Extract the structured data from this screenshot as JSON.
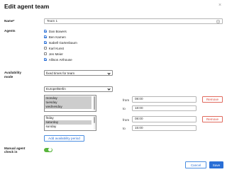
{
  "dialog": {
    "title": "Edit agent team",
    "close_symbol": "×"
  },
  "name_field": {
    "label": "Name*",
    "value": "Team 1",
    "icon": "id-card-icon"
  },
  "agents": {
    "label": "Agents",
    "items": [
      {
        "name": "Dan Bowers",
        "checked": true
      },
      {
        "name": "Ben Kamen",
        "checked": true
      },
      {
        "name": "Isabell Gartenbaum",
        "checked": true
      },
      {
        "name": "Karl Kunst",
        "checked": false
      },
      {
        "name": "Jen Meier",
        "checked": false
      },
      {
        "name": "Allison Arthouse",
        "checked": true
      }
    ]
  },
  "availability": {
    "label_line1": "Availability",
    "label_line2": "mode",
    "mode_value": "fixed times for team",
    "timezone_value": "Europe/Berlin",
    "periods": [
      {
        "days": [
          "monday",
          "tuesday",
          "wednesday"
        ],
        "selected": [
          true,
          true,
          true
        ],
        "from_label": "from",
        "from_value": "08:00",
        "to_label": "to",
        "to_value": "18:00",
        "remove_label": "Remove"
      },
      {
        "days": [
          "friday",
          "saturday",
          "sunday"
        ],
        "selected": [
          false,
          true,
          false
        ],
        "from_label": "from",
        "from_value": "08:00",
        "to_label": "to",
        "to_value": "15:00",
        "remove_label": "Remove"
      }
    ],
    "add_label": "Add availability period"
  },
  "manual_checkin": {
    "label_line1": "Manual agent",
    "label_line2": "check in",
    "enabled": true
  },
  "footer": {
    "cancel_label": "Cancel",
    "save_label": "Save"
  },
  "colors": {
    "accent": "#2a6fd6",
    "danger": "#d9473a",
    "toggle_on": "#58b53c"
  }
}
